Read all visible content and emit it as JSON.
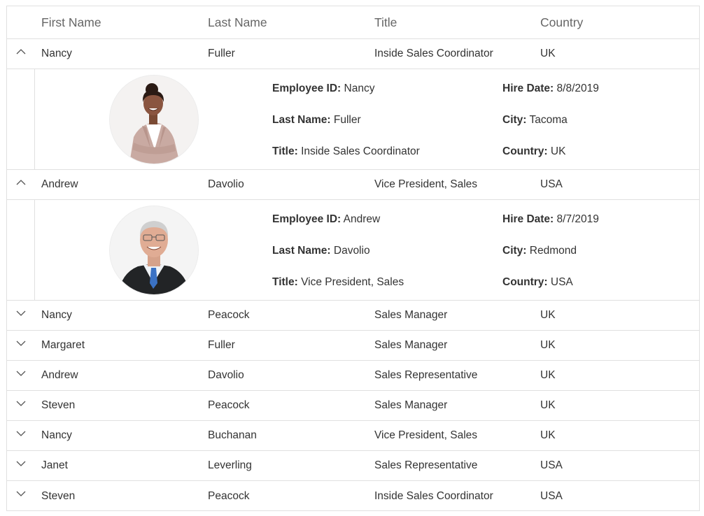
{
  "columns": {
    "first_name": "First Name",
    "last_name": "Last Name",
    "title": "Title",
    "country": "Country"
  },
  "detail_labels": {
    "employee_id": "Employee ID:",
    "last_name": "Last Name:",
    "title": "Title:",
    "hire_date": "Hire Date:",
    "city": "City:",
    "country": "Country:"
  },
  "rows": [
    {
      "first_name": "Nancy",
      "last_name": "Fuller",
      "title": "Inside Sales Coordinator",
      "country": "UK",
      "expanded": true,
      "detail": {
        "employee_id": "Nancy",
        "last_name": "Fuller",
        "title": "Inside Sales Coordinator",
        "hire_date": "8/8/2019",
        "city": "Tacoma",
        "country": "UK"
      }
    },
    {
      "first_name": "Andrew",
      "last_name": "Davolio",
      "title": "Vice President, Sales",
      "country": "USA",
      "expanded": true,
      "detail": {
        "employee_id": "Andrew",
        "last_name": "Davolio",
        "title": "Vice President, Sales",
        "hire_date": "8/7/2019",
        "city": "Redmond",
        "country": "USA"
      }
    },
    {
      "first_name": "Nancy",
      "last_name": "Peacock",
      "title": "Sales Manager",
      "country": "UK",
      "expanded": false
    },
    {
      "first_name": "Margaret",
      "last_name": "Fuller",
      "title": "Sales Manager",
      "country": "UK",
      "expanded": false
    },
    {
      "first_name": "Andrew",
      "last_name": "Davolio",
      "title": "Sales Representative",
      "country": "UK",
      "expanded": false
    },
    {
      "first_name": "Steven",
      "last_name": "Peacock",
      "title": "Sales Manager",
      "country": "UK",
      "expanded": false
    },
    {
      "first_name": "Nancy",
      "last_name": "Buchanan",
      "title": "Vice President, Sales",
      "country": "UK",
      "expanded": false
    },
    {
      "first_name": "Janet",
      "last_name": "Leverling",
      "title": "Sales Representative",
      "country": "USA",
      "expanded": false
    },
    {
      "first_name": "Steven",
      "last_name": "Peacock",
      "title": "Inside Sales Coordinator",
      "country": "USA",
      "expanded": false
    }
  ],
  "icons": {
    "expanded": "chevron-up-icon",
    "collapsed": "chevron-down-icon"
  },
  "colors": {
    "border": "#e0e0e0",
    "header_text": "#666666",
    "body_text": "#333333"
  }
}
